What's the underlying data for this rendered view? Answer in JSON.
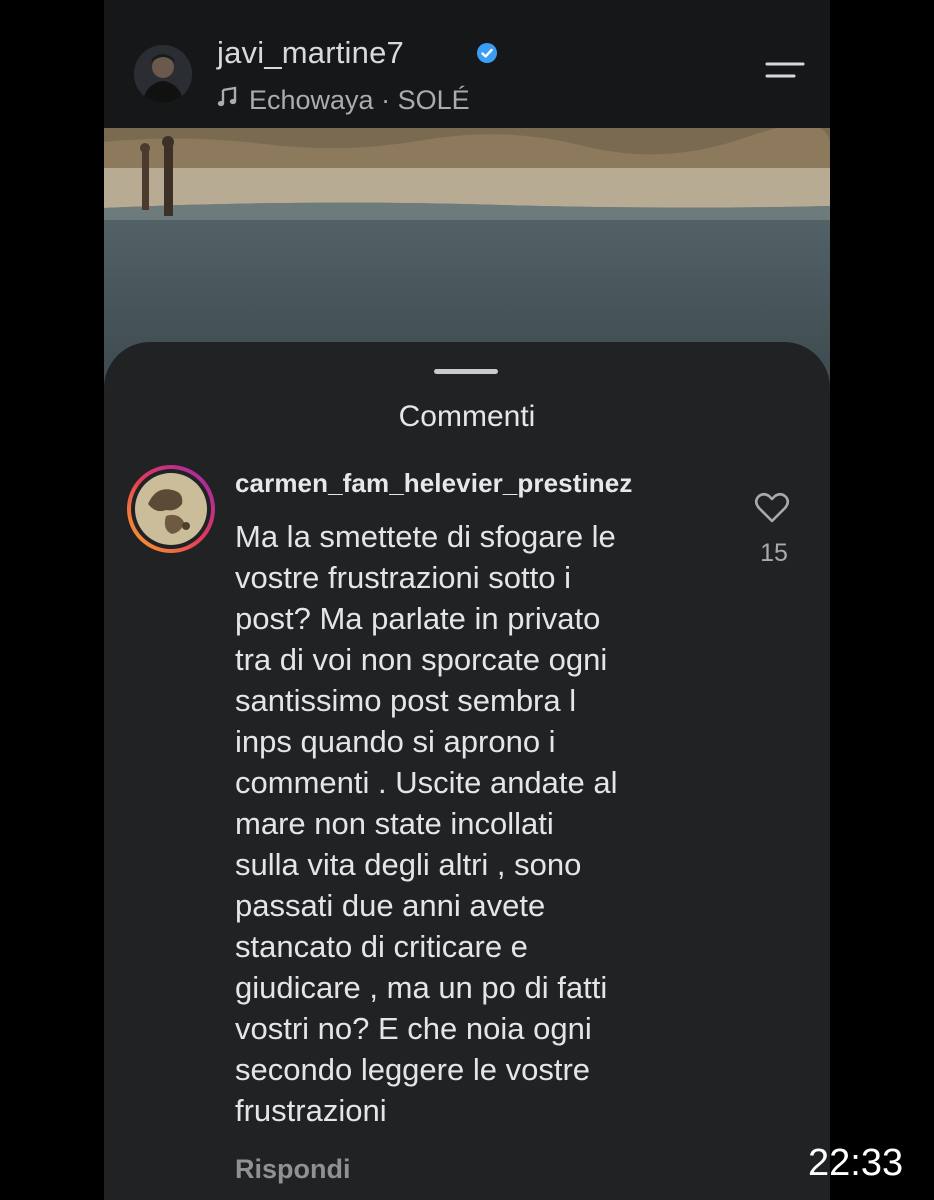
{
  "post": {
    "username": "javi_martine7",
    "audio": "Echowaya · SOLÉ",
    "icons": {
      "avatar": "profile-photo",
      "verified": "verified-badge-icon",
      "music": "music-note-icon",
      "menu": "menu-icon"
    }
  },
  "comments_sheet": {
    "title": "Commenti",
    "comment": {
      "username": "carmen_fam_helevier_prestinez",
      "text_lines": [
        "Ma la smettete di sfogare le",
        "vostre frustrazioni sotto i",
        "post? Ma parlate in privato",
        "tra di voi non sporcate ogni",
        "santissimo post sembra l",
        "inps quando si aprono i",
        "commenti . Uscite andate al",
        "mare non state incollati",
        "sulla vita degli altri , sono",
        "passati due anni avete",
        "stancato di criticare e",
        "giudicare , ma un po di fatti",
        "vostri no? E che noia ogni",
        "secondo leggere le vostre",
        "frustrazioni"
      ],
      "like_count": "15",
      "reply_label": "Rispondi"
    }
  },
  "overlay": {
    "time": "22:33"
  },
  "colors": {
    "background": "#000000",
    "sheet": "#202224",
    "verified": "#3b9ef5",
    "story_ring_start": "#f9a825",
    "story_ring_end": "#c2185b"
  }
}
